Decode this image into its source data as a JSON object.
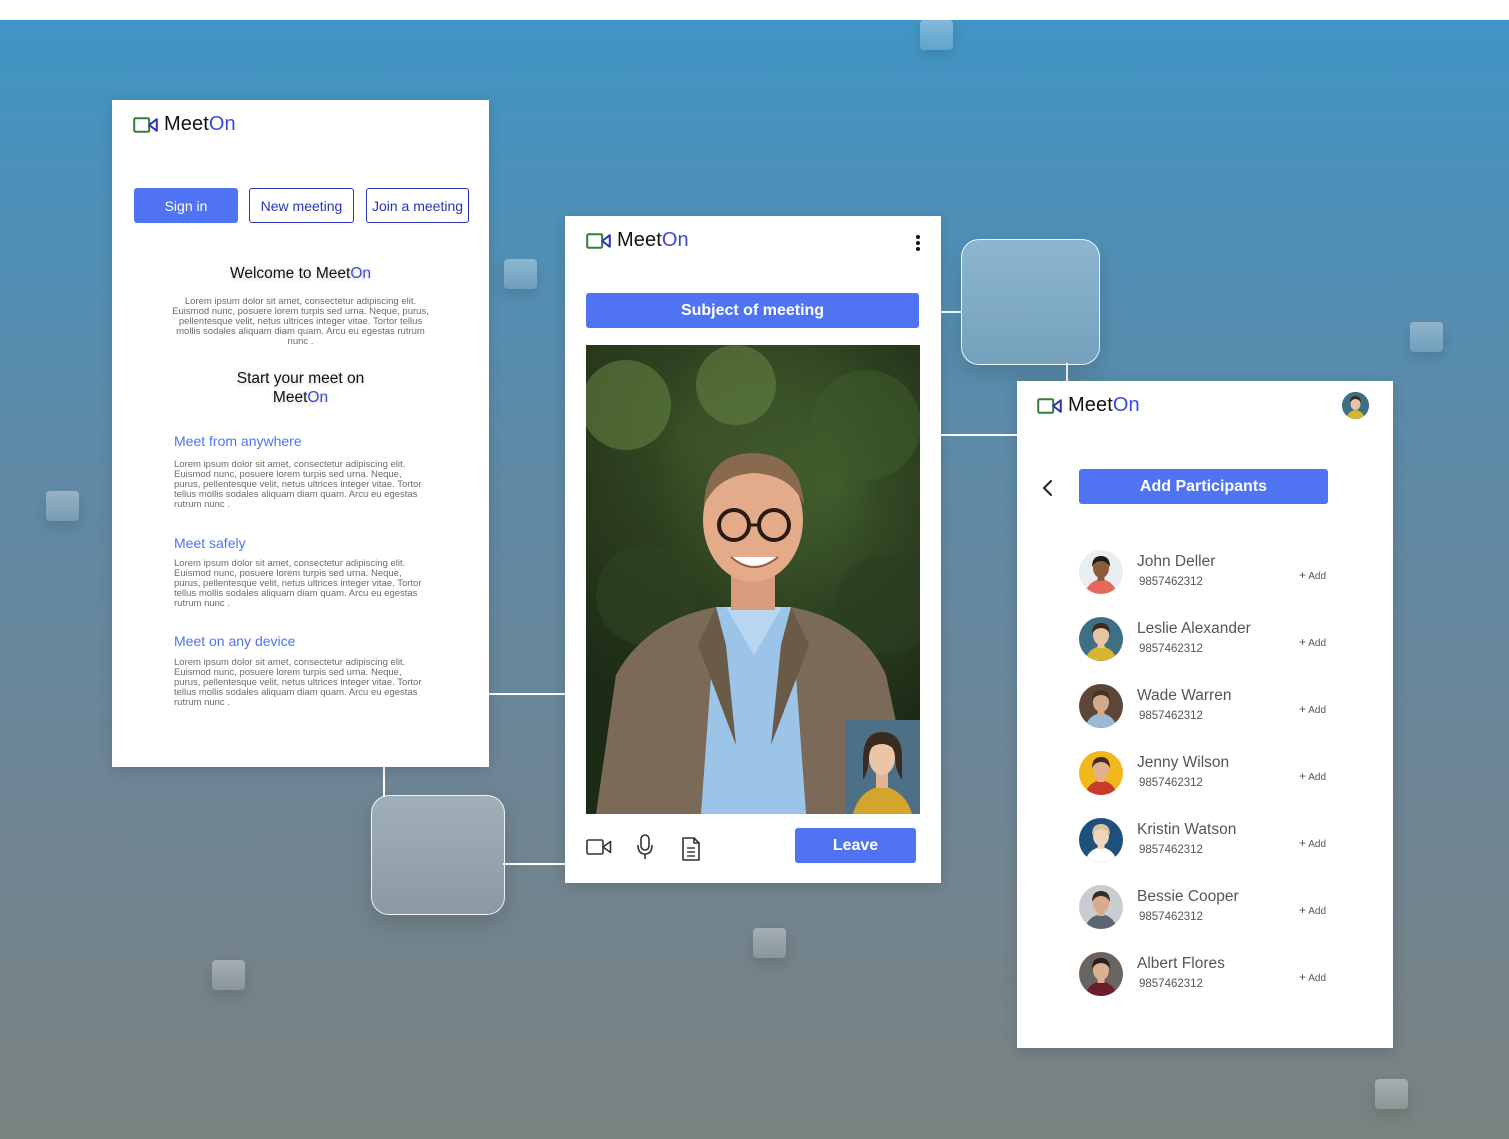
{
  "brand": {
    "name_part1": "Meet",
    "name_part2": "On"
  },
  "home": {
    "sign_in": "Sign in",
    "new_meeting": "New meeting",
    "join_meeting": "Join a meeting",
    "welcome_prefix": "Welcome to ",
    "welcome_brand1": "Meet",
    "welcome_brand2": "On",
    "welcome_body": "Lorem ipsum dolor sit amet, consectetur adipiscing elit. Euismod nunc, posuere lorem turpis sed urna. Neque, purus, pellentesque velit, netus ultrices integer vitae. Tortor tellus mollis sodales aliquam diam quam. Arcu eu egestas rutrum nunc .",
    "start_line1": "Start your meet on",
    "start_brand1": "Meet",
    "start_brand2": "On",
    "features": [
      {
        "title": "Meet from anywhere",
        "body": "Lorem ipsum dolor sit amet, consectetur adipiscing elit. Euismod nunc, posuere lorem turpis sed urna. Neque, purus, pellentesque velit, netus ultrices integer vitae. Tortor tellus mollis sodales aliquam diam quam. Arcu eu egestas rutrum nunc ."
      },
      {
        "title": "Meet safely",
        "body": "Lorem ipsum dolor sit amet, consectetur adipiscing elit. Euismod nunc, posuere lorem turpis sed urna. Neque, purus, pellentesque velit, netus ultrices integer vitae. Tortor tellus mollis sodales aliquam diam quam. Arcu eu egestas rutrum nunc ."
      },
      {
        "title": "Meet on any device",
        "body": "Lorem ipsum dolor sit amet, consectetur adipiscing elit. Euismod nunc, posuere lorem turpis sed urna. Neque, purus, pellentesque velit, netus ultrices integer vitae. Tortor tellus mollis sodales aliquam diam quam. Arcu eu egestas rutrum nunc ."
      }
    ]
  },
  "meeting": {
    "subject": "Subject of meeting",
    "leave": "Leave",
    "icons": [
      "more-vertical-icon",
      "video-camera-icon",
      "microphone-icon",
      "document-icon"
    ]
  },
  "participants": {
    "title": "Add Participants",
    "add_label": "Add",
    "list": [
      {
        "name": "John Deller",
        "phone": "9857462312",
        "bg": "#e9eef3",
        "skin": "#8d5a3b",
        "hair": "#1e1a18",
        "shirt": "#e56a5c"
      },
      {
        "name": "Leslie Alexander",
        "phone": "9857462312",
        "bg": "#3f6f83",
        "skin": "#e7c4a5",
        "hair": "#3a2a20",
        "shirt": "#d6b531"
      },
      {
        "name": "Wade Warren",
        "phone": "9857462312",
        "bg": "#5b4638",
        "skin": "#d6a98a",
        "hair": "#4a3122",
        "shirt": "#9db7d6"
      },
      {
        "name": "Jenny Wilson",
        "phone": "9857462312",
        "bg": "#f1b81e",
        "skin": "#e2b18e",
        "hair": "#4a2a1b",
        "shirt": "#c93a2b"
      },
      {
        "name": "Kristin Watson",
        "phone": "9857462312",
        "bg": "#1f4f7b",
        "skin": "#f0d3bd",
        "hair": "#d8c49a",
        "shirt": "#ffffff"
      },
      {
        "name": "Bessie Cooper",
        "phone": "9857462312",
        "bg": "#c9cdd2",
        "skin": "#d9aa8c",
        "hair": "#3a2a22",
        "shirt": "#5b6470"
      },
      {
        "name": "Albert Flores",
        "phone": "9857462312",
        "bg": "#6a6460",
        "skin": "#dcb192",
        "hair": "#2a1f1a",
        "shirt": "#6c1d2b"
      }
    ]
  },
  "colors": {
    "accent": "#4f73f2",
    "brand_on": "#3b49d6",
    "logo_green": "#2e7d3e"
  }
}
